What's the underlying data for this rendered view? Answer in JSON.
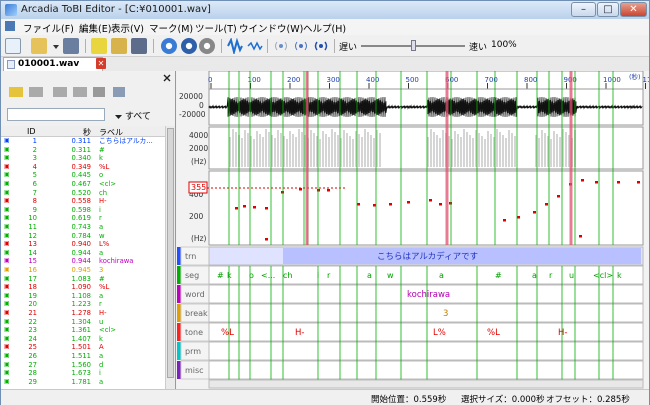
{
  "window": {
    "title": "Arcadia ToBI Editor - [C:¥010001.wav]",
    "minimize": "–",
    "maximize": "□",
    "close": "✕"
  },
  "menu": [
    "ファイル(F)",
    "編集(E)",
    "表示(V)",
    "マーク(M)",
    "ツール(T)",
    "ウインドウ(W)",
    "ヘルプ(H)"
  ],
  "toolbar": {
    "speed_slow": "遅い",
    "speed_fast": "速い",
    "speed_pct": "100%"
  },
  "tab": {
    "label": "010001.wav",
    "close": "✕"
  },
  "filter": {
    "value": "",
    "dropdown": "すべて"
  },
  "list_header": {
    "id": "ID",
    "time": "秒",
    "label": "ラベル"
  },
  "marks": [
    {
      "id": "1",
      "time": "0.311",
      "label": "こちらはアルカ...",
      "color": "#0040ff"
    },
    {
      "id": "2",
      "time": "0.311",
      "label": "#",
      "color": "#00b000"
    },
    {
      "id": "3",
      "time": "0.340",
      "label": "k",
      "color": "#00b000"
    },
    {
      "id": "4",
      "time": "0.349",
      "label": "%L",
      "color": "#e00000"
    },
    {
      "id": "5",
      "time": "0.445",
      "label": "o",
      "color": "#00b000"
    },
    {
      "id": "6",
      "time": "0.467",
      "label": "<cl>",
      "color": "#00b000"
    },
    {
      "id": "7",
      "time": "0.520",
      "label": "ch",
      "color": "#00b000"
    },
    {
      "id": "8",
      "time": "0.558",
      "label": "H-",
      "color": "#e00000"
    },
    {
      "id": "9",
      "time": "0.598",
      "label": "i",
      "color": "#00b000"
    },
    {
      "id": "10",
      "time": "0.619",
      "label": "r",
      "color": "#00b000"
    },
    {
      "id": "11",
      "time": "0.743",
      "label": "a",
      "color": "#00b000"
    },
    {
      "id": "12",
      "time": "0.784",
      "label": "w",
      "color": "#00b000"
    },
    {
      "id": "13",
      "time": "0.940",
      "label": "L%",
      "color": "#e00000"
    },
    {
      "id": "14",
      "time": "0.944",
      "label": "a",
      "color": "#00b000"
    },
    {
      "id": "15",
      "time": "0.944",
      "label": "kochirawa",
      "color": "#c000c0"
    },
    {
      "id": "16",
      "time": "0.945",
      "label": "3",
      "color": "#e0a000"
    },
    {
      "id": "17",
      "time": "1.083",
      "label": "#",
      "color": "#00b000"
    },
    {
      "id": "18",
      "time": "1.090",
      "label": "%L",
      "color": "#e00000"
    },
    {
      "id": "19",
      "time": "1.108",
      "label": "a",
      "color": "#00b000"
    },
    {
      "id": "20",
      "time": "1.223",
      "label": "r",
      "color": "#00b000"
    },
    {
      "id": "21",
      "time": "1.278",
      "label": "H-",
      "color": "#e00000"
    },
    {
      "id": "22",
      "time": "1.304",
      "label": "u",
      "color": "#00b000"
    },
    {
      "id": "23",
      "time": "1.361",
      "label": "<cl>",
      "color": "#00b000"
    },
    {
      "id": "24",
      "time": "1.407",
      "label": "k",
      "color": "#00b000"
    },
    {
      "id": "25",
      "time": "1.501",
      "label": "A",
      "color": "#e00000"
    },
    {
      "id": "26",
      "time": "1.511",
      "label": "a",
      "color": "#00b000"
    },
    {
      "id": "27",
      "time": "1.560",
      "label": "d",
      "color": "#00b000"
    },
    {
      "id": "28",
      "time": "1.673",
      "label": "i",
      "color": "#00b000"
    },
    {
      "id": "29",
      "time": "1.781",
      "label": "a",
      "color": "#00b000"
    }
  ],
  "ruler": {
    "ticks": [
      "0",
      "100",
      "200",
      "300",
      "400",
      "500",
      "600",
      "700",
      "800",
      "900",
      "1000",
      "1100"
    ],
    "unit": "(秒)"
  },
  "waveform": {
    "labels": [
      "20000",
      "0",
      "-20000"
    ]
  },
  "spectrogram": {
    "labels": [
      "4000",
      "2000",
      "(Hz)"
    ]
  },
  "pitch": {
    "labels": [
      "400",
      "200",
      "(Hz)"
    ],
    "cursor_value": "355"
  },
  "tiers": [
    {
      "name": "trn",
      "color": "#2050ff"
    },
    {
      "name": "seg",
      "color": "#00b000"
    },
    {
      "name": "word",
      "color": "#c000c0"
    },
    {
      "name": "break",
      "color": "#e0a000"
    },
    {
      "name": "tone",
      "color": "#ff2020"
    },
    {
      "name": "prm",
      "color": "#00c8c8"
    },
    {
      "name": "misc",
      "color": "#8020c0"
    }
  ],
  "tier_labels": {
    "trn": [
      "こちらはアルカディアです"
    ],
    "seg": [
      "#",
      "k",
      "o",
      "<...",
      "ch",
      "i",
      "r",
      "a",
      "w",
      "a",
      "#",
      "a",
      "r",
      "u",
      "<cl>",
      "k"
    ],
    "word": [
      "kochirawa"
    ],
    "break": [
      "3"
    ],
    "tone": [
      "%L",
      "H-",
      "L%",
      "%L",
      "H-"
    ]
  },
  "status": {
    "start": "開始位置：0.559秒",
    "sel": "選択サイズ：0.000秒",
    "offset": "オフセット：0.285秒"
  }
}
